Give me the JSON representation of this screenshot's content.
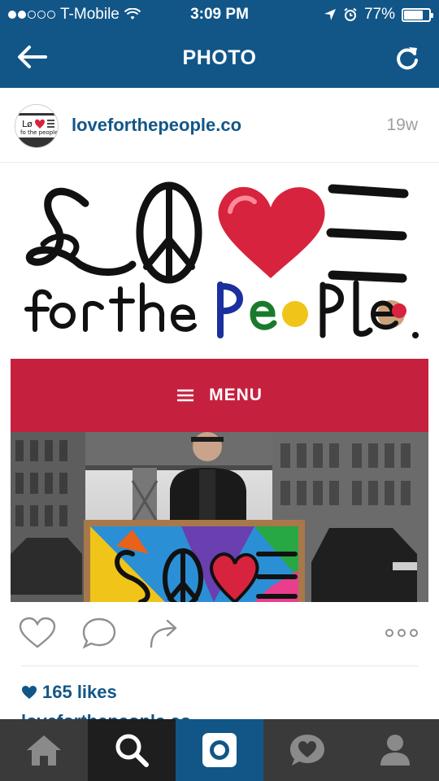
{
  "status_bar": {
    "carrier": "T-Mobile",
    "time": "3:09 PM",
    "battery": "77%",
    "battery_level": 0.77,
    "signal_bars": 2
  },
  "nav": {
    "title": "PHOTO",
    "back_icon": "back-arrow-icon",
    "refresh_icon": "refresh-icon"
  },
  "post": {
    "username": "loveforthepeople.co",
    "age": "19w",
    "image": {
      "logo_line2": "for the people.",
      "menu_label": "MENU"
    }
  },
  "engagement": {
    "likes": "165 likes",
    "caption_peek": "loveforthepeople.co"
  },
  "colors": {
    "brand_blue": "#125688",
    "menu_red": "#c5213f",
    "tab_bg": "#3a3a3a"
  },
  "tabbar": {
    "tabs": [
      {
        "icon": "home-icon"
      },
      {
        "icon": "search-icon"
      },
      {
        "icon": "camera-icon"
      },
      {
        "icon": "activity-heart-icon"
      },
      {
        "icon": "profile-icon"
      }
    ],
    "active_index": 2
  }
}
